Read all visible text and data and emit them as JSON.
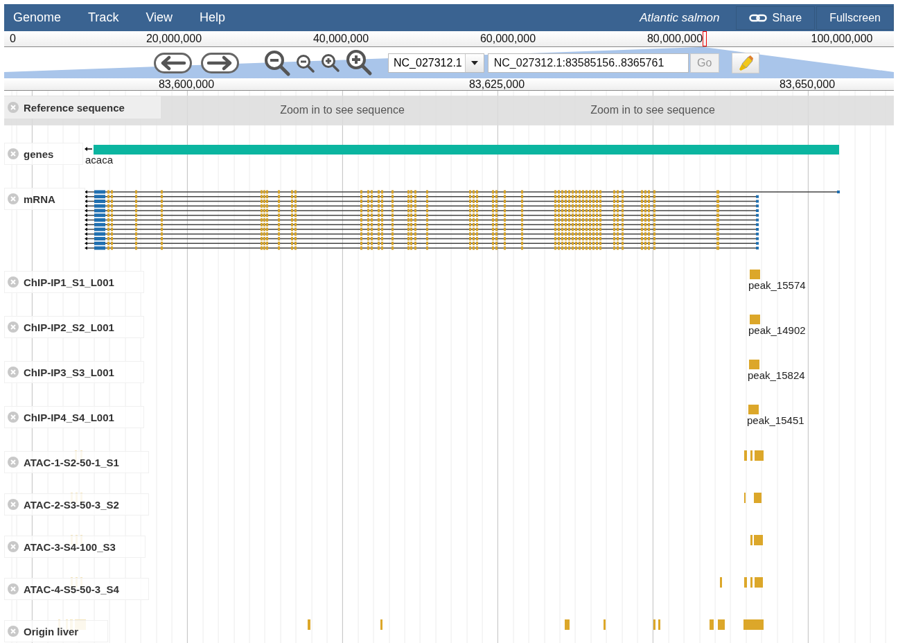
{
  "menu": [
    {
      "label": "Genome"
    },
    {
      "label": "Track"
    },
    {
      "label": "View"
    },
    {
      "label": "Help"
    }
  ],
  "dataset": "Atlantic salmon",
  "header_buttons": [
    {
      "kind": "share",
      "label": "Share"
    },
    {
      "kind": "fullscreen",
      "label": "Fullscreen"
    }
  ],
  "overview_ruler": {
    "ticks": [
      "0",
      "20,000,000",
      "40,000,000",
      "60,000,000",
      "80,000,000",
      "100,000,000"
    ]
  },
  "navigation": {
    "reference": "NC_027312.1",
    "location": "NC_027312.1:83585156..8365761",
    "go_button": {
      "label": "Go",
      "disabled": true
    }
  },
  "detail_ruler": {
    "ticks": [
      "83,600,000",
      "83,625,000",
      "83,650,000"
    ]
  },
  "tracks": [
    {
      "kind": "reference",
      "label": "Reference sequence",
      "messages": [
        "Zoom in to see sequence",
        "Zoom in to see sequence"
      ]
    },
    {
      "kind": "gene",
      "label": "genes",
      "feature_label": "acaca"
    },
    {
      "kind": "mrna",
      "label": "mRNA"
    },
    {
      "kind": "peak",
      "label": "ChIP-IP1_S1_L001",
      "feature_label": "peak_15574"
    },
    {
      "kind": "peak",
      "label": "ChIP-IP2_S2_L001",
      "feature_label": "peak_14902"
    },
    {
      "kind": "peak",
      "label": "ChIP-IP3_S3_L001",
      "feature_label": "peak_15824"
    },
    {
      "kind": "peak",
      "label": "ChIP-IP4_S4_L001",
      "feature_label": "peak_15451"
    },
    {
      "kind": "coverage",
      "label": "ATAC-1-S2-50-1_S1"
    },
    {
      "kind": "coverage",
      "label": "ATAC-2-S3-50-3_S2"
    },
    {
      "kind": "coverage",
      "label": "ATAC-3-S4-100_S3"
    },
    {
      "kind": "coverage",
      "label": "ATAC-4-S5-50-3_S4"
    },
    {
      "kind": "coverage",
      "label": "Origin liver"
    }
  ]
}
